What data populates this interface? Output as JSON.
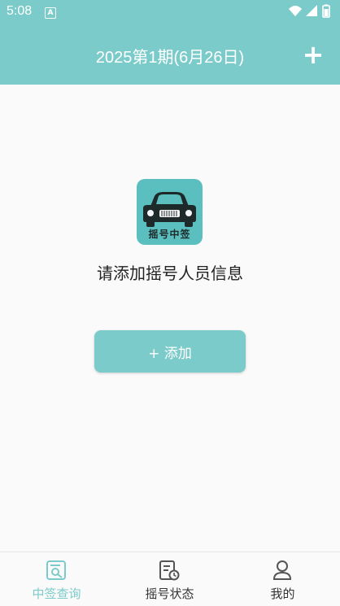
{
  "status_bar": {
    "time": "5:08",
    "notification_letter": "A"
  },
  "header": {
    "title": "2025第1期(6月26日)",
    "add_icon": "plus-icon",
    "add_symbol": "+"
  },
  "main": {
    "logo_text": "摇号中签",
    "prompt": "请添加摇号人员信息",
    "add_button_label": "+ 添加"
  },
  "tabs": [
    {
      "label": "中签查询",
      "icon": "search-document-icon",
      "active": true
    },
    {
      "label": "摇号状态",
      "icon": "document-clock-icon",
      "active": false
    },
    {
      "label": "我的",
      "icon": "person-icon",
      "active": false
    }
  ],
  "colors": {
    "accent": "#7ccbcb",
    "logo_bg": "#5cbfbf",
    "background": "#fafafa",
    "text_dark": "#222222"
  }
}
